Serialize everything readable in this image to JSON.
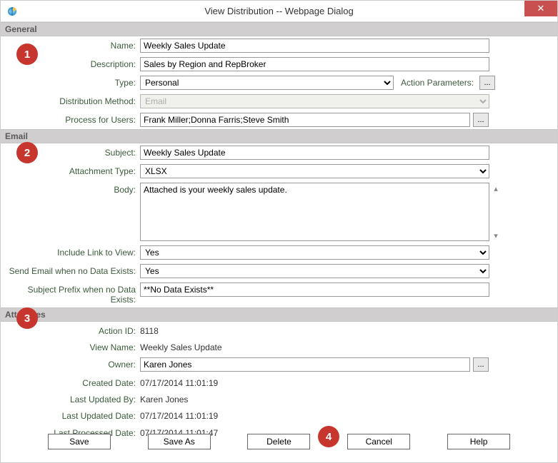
{
  "window": {
    "title": "View Distribution -- Webpage Dialog"
  },
  "sections": {
    "general": {
      "title": "General"
    },
    "email": {
      "title": "Email"
    },
    "attributes": {
      "title": "Attributes"
    }
  },
  "general": {
    "name_label": "Name:",
    "name_value": "Weekly Sales Update",
    "description_label": "Description:",
    "description_value": "Sales by Region and RepBroker",
    "type_label": "Type:",
    "type_value": "Personal",
    "action_params_label": "Action Parameters:",
    "dist_method_label": "Distribution Method:",
    "dist_method_value": "Email",
    "process_users_label": "Process for Users:",
    "process_users_value": "Frank Miller;Donna Farris;Steve Smith"
  },
  "email": {
    "subject_label": "Subject:",
    "subject_value": "Weekly Sales Update",
    "attach_label": "Attachment Type:",
    "attach_value": "XLSX",
    "body_label": "Body:",
    "body_value": "Attached is your weekly sales update.",
    "include_link_label": "Include Link to View:",
    "include_link_value": "Yes",
    "send_nodata_label": "Send Email when no Data Exists:",
    "send_nodata_value": "Yes",
    "prefix_label": "Subject Prefix when no Data Exists:",
    "prefix_value": "**No Data Exists**"
  },
  "attributes": {
    "action_id_label": "Action ID:",
    "action_id_value": "8118",
    "view_name_label": "View Name:",
    "view_name_value": "Weekly Sales Update",
    "owner_label": "Owner:",
    "owner_value": "Karen Jones",
    "created_label": "Created Date:",
    "created_value": "07/17/2014 11:01:19",
    "updated_by_label": "Last Updated By:",
    "updated_by_value": "Karen Jones",
    "updated_date_label": "Last Updated Date:",
    "updated_date_value": "07/17/2014 11:01:19",
    "processed_label": "Last Processed Date:",
    "processed_value": "07/17/2014 11:01:47"
  },
  "buttons": {
    "save": "Save",
    "save_as": "Save As",
    "delete": "Delete",
    "cancel": "Cancel",
    "help": "Help"
  },
  "callouts": {
    "c1": "1",
    "c2": "2",
    "c3": "3",
    "c4": "4"
  }
}
